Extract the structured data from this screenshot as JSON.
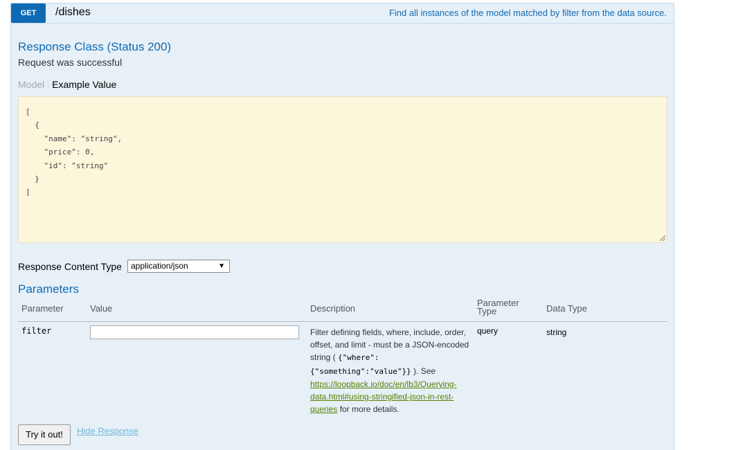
{
  "operation": {
    "method": "GET",
    "path": "/dishes",
    "summary": "Find all instances of the model matched by filter from the data source."
  },
  "response": {
    "class_title": "Response Class (Status 200)",
    "description": "Request was successful",
    "tabs": {
      "model": "Model",
      "example": "Example Value"
    },
    "example_lines": [
      "[",
      "  {",
      "    \"name\": \"string\",",
      "    \"price\": 0,",
      "    \"id\": \"string\"",
      "  }",
      "]"
    ],
    "content_type_label": "Response Content Type",
    "content_type_value": "application/json"
  },
  "parameters": {
    "title": "Parameters",
    "headers": {
      "parameter": "Parameter",
      "value": "Value",
      "description": "Description",
      "param_type_1": "Parameter",
      "param_type_2": "Type",
      "data_type": "Data Type"
    },
    "rows": [
      {
        "name": "filter",
        "value": "",
        "desc_1": "Filter defining fields, where, include, order, offset, and limit - must be a JSON-encoded string (",
        "desc_code_1": "{\"where\":",
        "desc_code_2": "{\"something\":\"value\"}}",
        "desc_2": "). See",
        "link": "https://loopback.io/doc/en/lb3/Querying-data.html#using-stringified-json-in-rest-queries",
        "desc_3": "for more details.",
        "param_type": "query",
        "data_type": "string"
      }
    ]
  },
  "actions": {
    "try_label": "Try it out!",
    "hide_label": "Hide Response"
  }
}
